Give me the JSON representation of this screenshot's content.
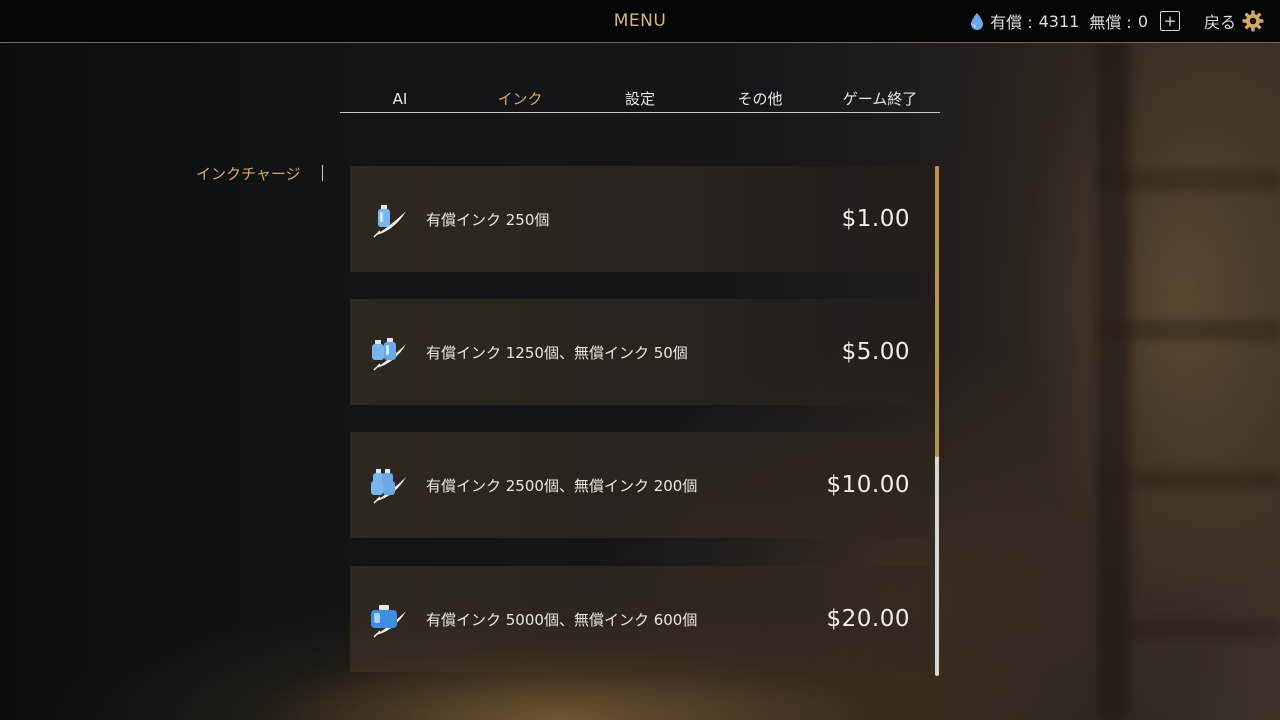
{
  "topbar": {
    "title": "MENU",
    "paid_label": "有償 :",
    "paid_value": "4311",
    "free_label": "無償 :",
    "free_value": "0",
    "add_label": "+",
    "back_label": "戻る"
  },
  "tabs": [
    {
      "label": "AI",
      "active": false
    },
    {
      "label": "インク",
      "active": true
    },
    {
      "label": "設定",
      "active": false
    },
    {
      "label": "その他",
      "active": false
    },
    {
      "label": "ゲーム終了",
      "active": false
    }
  ],
  "section": {
    "label": "インクチャージ"
  },
  "items": [
    {
      "label": "有償インク 250個",
      "price": "$1.00",
      "icon": "ink-bottle-single-icon"
    },
    {
      "label": "有償インク 1250個、無償インク 50個",
      "price": "$5.00",
      "icon": "ink-bottle-double-icon"
    },
    {
      "label": "有償インク 2500個、無償インク 200個",
      "price": "$10.00",
      "icon": "ink-bottle-triple-icon"
    },
    {
      "label": "有償インク 5000個、無償インク 600個",
      "price": "$20.00",
      "icon": "ink-pot-icon"
    }
  ],
  "scroll": {
    "position_fraction": 0.57
  },
  "colors": {
    "accent": "#d4aa62",
    "ink": "#6fa8e8"
  }
}
